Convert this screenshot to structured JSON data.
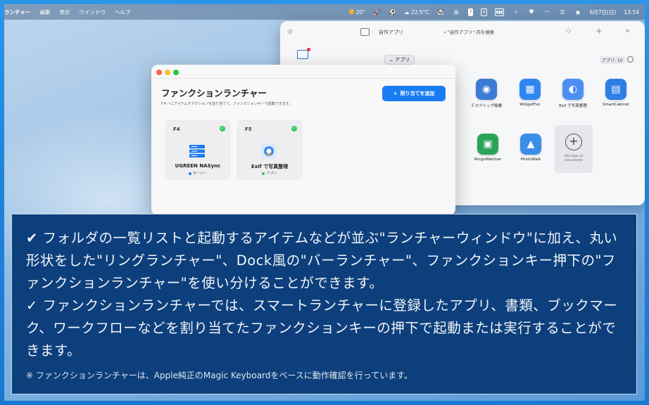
{
  "menubar": {
    "app": "ランチャー",
    "items": [
      "編集",
      "表示",
      "ウインドウ",
      "ヘルプ"
    ],
    "weather1": "20°",
    "weather2": "22.5°C",
    "calendar_day": "7",
    "input_label": "A",
    "date": "6月7日(日)",
    "time": "13:54"
  },
  "bg_window": {
    "title": "自作アプリ",
    "search": "\"自作アプリ\" 内を検索",
    "dropdown": "アプリ",
    "count": "アプリ: 10",
    "apps": [
      {
        "name": "デスクトップ秘書",
        "icon": "person-icon",
        "color": "#3a7bd5"
      },
      {
        "name": "WidgetFun",
        "icon": "grid-icon",
        "color": "#2f86f0"
      },
      {
        "name": "Exif で写真整理",
        "icon": "photo-icon",
        "color": "#4b8ff2"
      },
      {
        "name": "SmartCabinet",
        "icon": "cabinet-icon",
        "color": "#2d7ee5"
      },
      {
        "name": "RingoWatcher",
        "icon": "watch-icon",
        "color": "#2ba45a"
      },
      {
        "name": "PhotoWalk",
        "icon": "landscape-icon",
        "color": "#3a8ee8"
      }
    ],
    "add_label": "Add Apps or Documents"
  },
  "fn_window": {
    "title": "ファンクションランチャー",
    "subtitle": "Fキーにアイテムやアクションを割り当てて、ファンクションキーで起動できます。",
    "assign_button": "割り当てを追加",
    "cards": [
      {
        "key": "F4",
        "name": "UGREEN NASync",
        "type": "サーバー",
        "type_color": "#1a7cf2"
      },
      {
        "key": "F5",
        "name": "Exif で写真整理",
        "type": "アプリ",
        "type_color": "#34c759"
      }
    ]
  },
  "caption": {
    "para1": "✔︎ フォルダの一覧リストと起動するアイテムなどが並ぶ\"ランチャーウィンドウ\"に加え、丸い形状をした\"リングランチャー\"、Dock風の\"バーランチャー\"、ファンクションキー押下の\"ファンクションランチャー\"を使い分けることができます。",
    "para2": "✓ ファンクションランチャーでは、スマートランチャーに登録したアプリ、書類、ブックマーク、ワークフローなどを割り当てたファンクションキーの押下で起動または実行することができます。",
    "note": "※ ファンクションランチャーは、Apple純正のMagic Keyboardをベースに動作確認を行っています。"
  }
}
